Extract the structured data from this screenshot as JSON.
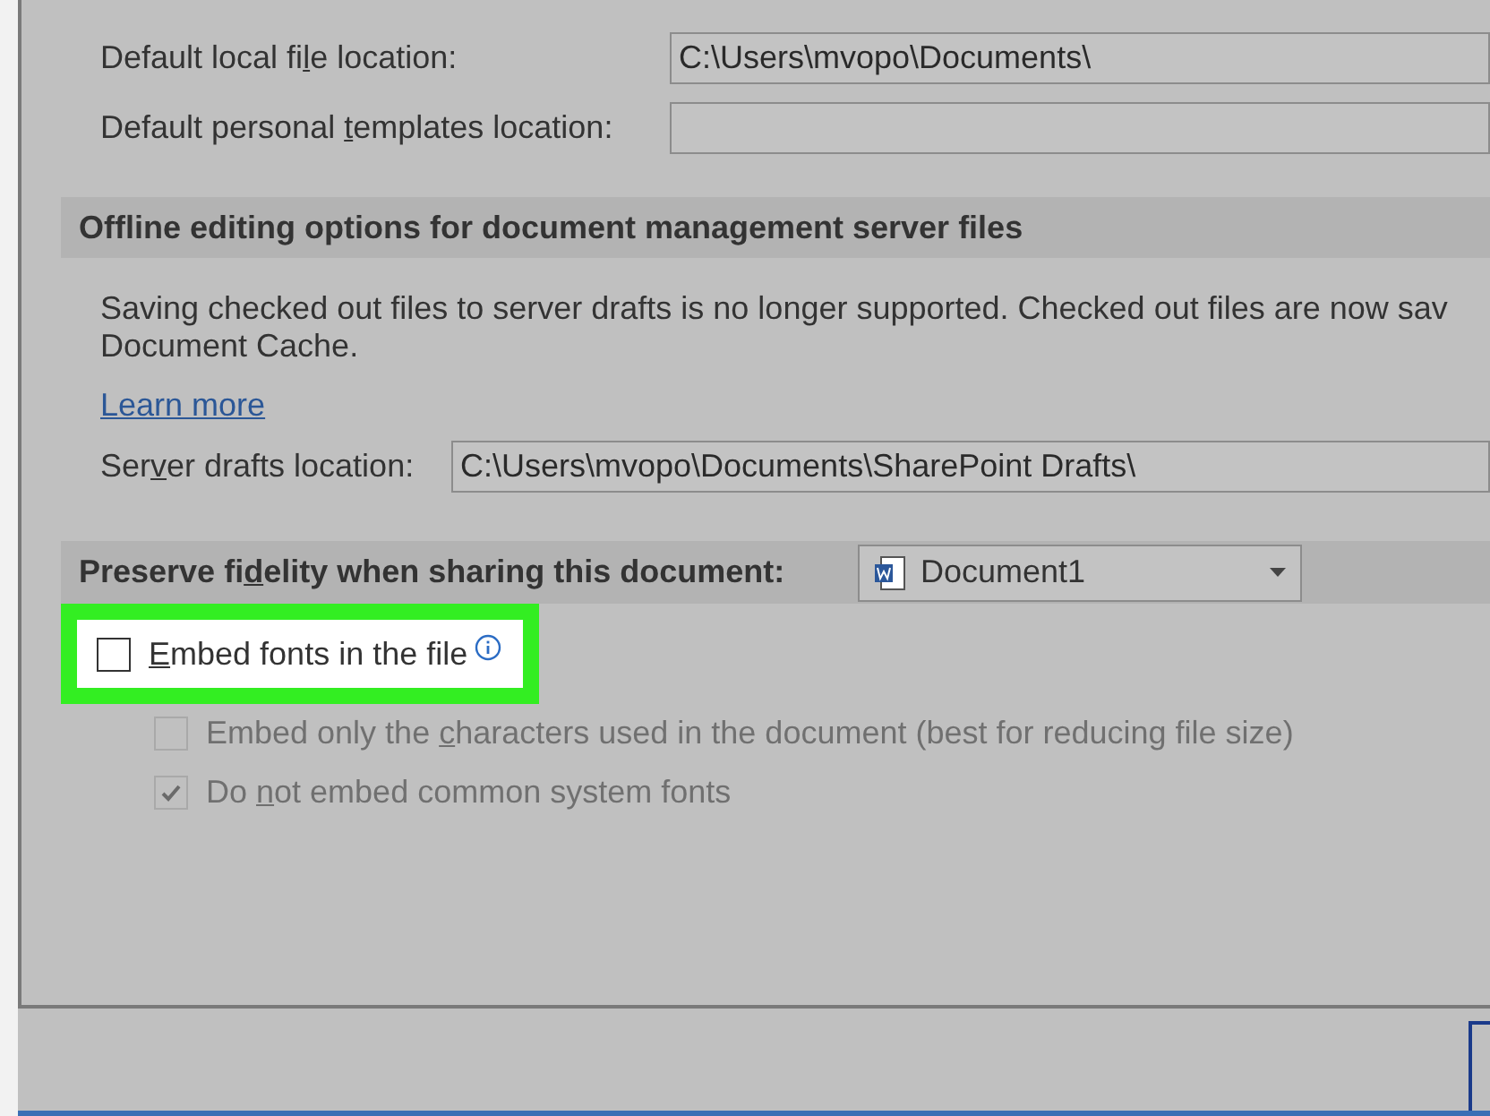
{
  "file_locations": [
    {
      "label": {
        "before": "Default local fi",
        "key": "l",
        "after": "e location:"
      },
      "value": "C:\\Users\\mvopo\\Documents\\"
    },
    {
      "label": {
        "before": "Default personal ",
        "key": "t",
        "after": "emplates location:"
      }
    }
  ],
  "offline_section": {
    "title": "Offline editing options for document management server files",
    "description": "Saving checked out files to server drafts is no longer supported. Checked out files are now sav",
    "description_line_2": "Document Cache.",
    "link": "Learn more",
    "server_drafts": {
      "label": {
        "before": "Ser",
        "key": "v",
        "after": "er drafts location:"
      },
      "value": "C:\\Users\\mvopo\\Documents\\SharePoint Drafts\\"
    }
  },
  "fidelity_section": {
    "title": {
      "before": "Preserve fi",
      "key": "d",
      "after": "elity when sharing this document:"
    },
    "document_dropdown": {
      "value": "Document1"
    },
    "options": [
      {
        "label": {
          "key": "E",
          "after": "mbed fonts in the file"
        },
        "checked": false,
        "disabled": false,
        "highlighted": true,
        "info": true
      },
      {
        "label": {
          "before": "Embed only the ",
          "key": "c",
          "after": "haracters used in the document (best for reducing file size)"
        },
        "checked": false,
        "disabled": true,
        "highlighted": false,
        "info": false
      },
      {
        "label": {
          "before": "Do ",
          "key": "n",
          "after": "ot embed common system fonts"
        },
        "checked": true,
        "disabled": true,
        "highlighted": false,
        "info": false
      }
    ]
  }
}
